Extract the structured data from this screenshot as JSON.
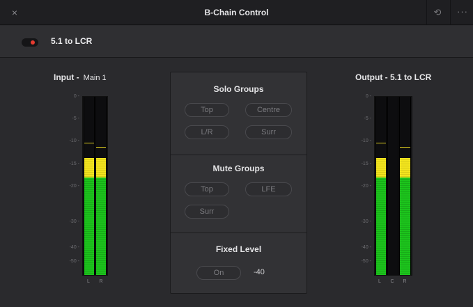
{
  "window": {
    "title": "B-Chain Control",
    "close_icon": "×",
    "reset_icon": "⟲",
    "more_icon": "···"
  },
  "preset": {
    "name": "5.1 to LCR",
    "enabled": true,
    "toggle_color": "#e63b30"
  },
  "input": {
    "title": "Input -",
    "subtitle": "Main 1",
    "scale": [
      "0 -",
      "-5 -",
      "-10 -",
      "-15 -",
      "-20 -",
      "-30 -",
      "-40 -",
      "-50 -"
    ],
    "channels": [
      "L",
      "R"
    ]
  },
  "output": {
    "title": "Output - 5.1 to LCR",
    "scale": [
      "0 -",
      "-5 -",
      "-10 -",
      "-15 -",
      "-20 -",
      "-30 -",
      "-40 -",
      "-50 -"
    ],
    "channels": [
      "L",
      "C",
      "R"
    ]
  },
  "solo_groups": {
    "title": "Solo Groups",
    "buttons": [
      "Top",
      "Centre",
      "L/R",
      "Surr"
    ]
  },
  "mute_groups": {
    "title": "Mute Groups",
    "buttons": [
      "Top",
      "LFE",
      "Surr"
    ]
  },
  "fixed_level": {
    "title": "Fixed Level",
    "button": "On",
    "value": "-40"
  },
  "colors": {
    "meter_green": "#1cc31c",
    "meter_yellow": "#f2e41e",
    "accent_red": "#e63b30"
  }
}
